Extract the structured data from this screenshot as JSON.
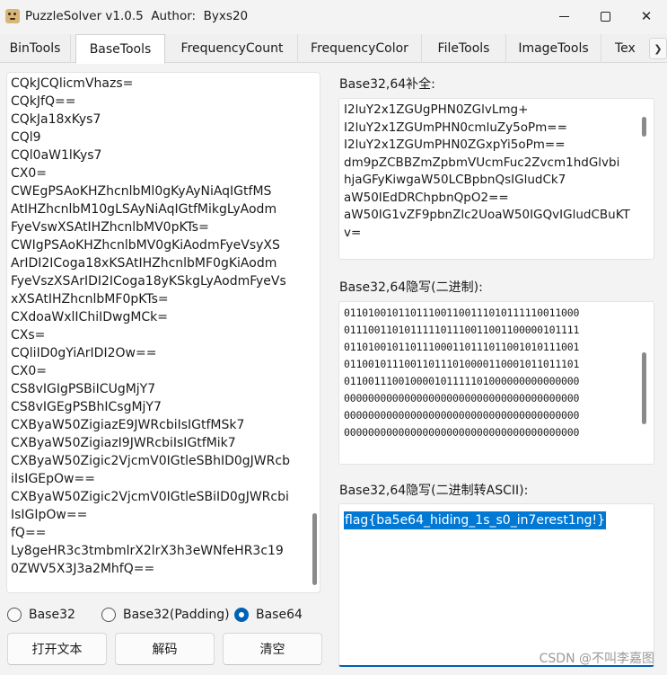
{
  "window": {
    "title": "PuzzleSolver v1.0.5  Author:  Byxs20",
    "controls": [
      "minimize-icon",
      "maximize-icon",
      "close-icon"
    ]
  },
  "tabs": [
    {
      "label": "BinTools",
      "active": false
    },
    {
      "label": "BaseTools",
      "active": true
    },
    {
      "label": "FrequencyCount",
      "active": false
    },
    {
      "label": "FrequencyColor",
      "active": false
    },
    {
      "label": "FileTools",
      "active": false
    },
    {
      "label": "ImageTools",
      "active": false
    },
    {
      "label": "Tex",
      "active": false
    }
  ],
  "tab_scroll_icon": "chevron-right-icon",
  "left": {
    "text": "CQkJCQlicmVhazs=\nCQkJfQ==\nCQkJa18xKys7\nCQl9\nCQl0aW1lKys7\nCX0=\nCWEgPSAoKHZhcnlbMl0gKyAyNiAqIGtfMS\nAtIHZhcnlbM10gLSAyNiAqIGtfMikgLyAodm\nFyeVswXSAtIHZhcnlbMV0pKTs=\nCWIgPSAoKHZhcnlbMV0gKiAodmFyeVsyXS\nArIDI2ICoga18xKSAtIHZhcnlbMF0gKiAodm\nFyeVszXSArIDI2ICoga18yKSkgLyAodmFyeVs\nxXSAtIHZhcnlbMF0pKTs=\nCXdoaWxlIChiIDwgMCk=\nCXs=\nCQliID0gYiArIDI2Ow==\nCX0=\nCS8vIGIgPSBiICUgMjY7\nCS8vIGEgPSBhICsgMjY7\nCXByaW50ZigiazE9JWRcbiIsIGtfMSk7\nCXByaW50ZigiazI9JWRcbiIsIGtfMik7\nCXByaW50Zigic2VjcmV0IGtleSBhID0gJWRcb\niIsIGEpOw==\nCXByaW50Zigic2VjcmV0IGtleSBiID0gJWRcbi\nIsIGIpOw==\nfQ==\nLy8geHR3c3tmbmlrX2lrX3h3eWNfeHR3c19\n0ZWV5X3J3a2MhfQ=="
  },
  "radios": [
    {
      "label": "Base32",
      "checked": false
    },
    {
      "label": "Base32(Padding)",
      "checked": false
    },
    {
      "label": "Base64",
      "checked": true
    }
  ],
  "buttons": {
    "open": "打开文本",
    "decode": "解码",
    "clear": "清空"
  },
  "right": {
    "padding_label": "Base32,64补全:",
    "padding_text": "I2luY2x1ZGUgPHN0ZGlvLmg+\nI2luY2x1ZGUmPHN0cmluZy5oPm==\nI2luY2x1ZGUmPHN0ZGxpYi5oPm==\ndm9pZCBBZmZpbmVUcmFuc2Zvcm1hdGlvbi\nhjaGFyKiwgaW50LCBpbnQsIGludCk7\naW50IEdDRChpbnQpO2==\naW50IG1vZF9pbnZlc2UoaW50IGQvIGludCBuKT\nv=",
    "binary_label": "Base32,64隐写(二进制):",
    "binary_text": "011010010110111001100111010111110011000\n011100110101111101110011001100000101111\n011010010110111000110111011001010111001\n011001011100110111010000110001011011101\n011001110010000101111101000000000000000\n000000000000000000000000000000000000000\n000000000000000000000000000000000000000\n000000000000000000000000000000000000000",
    "ascii_label": "Base32,64隐写(二进制转ASCII):",
    "ascii_text": "flag{ba5e64_hiding_1s_s0_in7erest1ng!}"
  },
  "watermark": "CSDN @不叫李嘉图"
}
